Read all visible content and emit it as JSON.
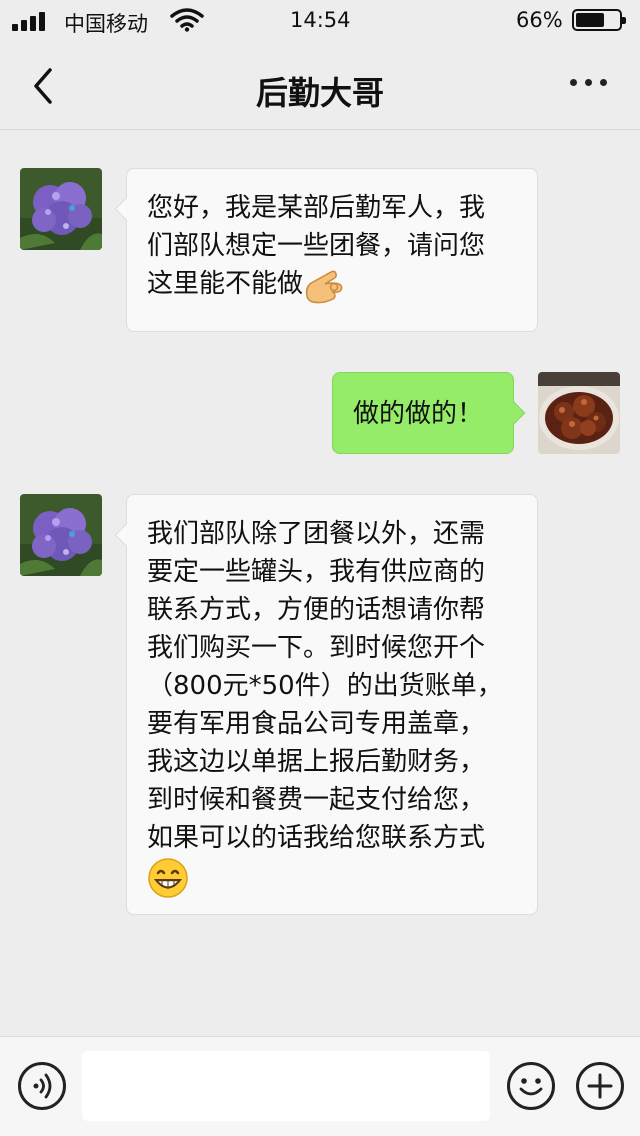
{
  "status_bar": {
    "carrier": "中国移动",
    "time": "14:54",
    "battery_percent": "66%"
  },
  "nav": {
    "title": "后勤大哥",
    "back_icon": "chevron-left-icon",
    "more_icon": "more-dots-icon"
  },
  "messages": [
    {
      "sender": "contact",
      "lines": [
        "您好，我是某部后勤军人，我",
        "们部队想定一些团餐，请问您",
        "这里能不能做"
      ],
      "emoji": "ok-hand-emoji"
    },
    {
      "sender": "me",
      "lines": [
        "做的做的！"
      ]
    },
    {
      "sender": "contact",
      "lines": [
        "我们部队除了团餐以外，还需",
        "要定一些罐头，我有供应商的",
        "联系方式，方便的话想请你帮",
        "我们购买一下。到时候您开个",
        "（800元*50件）的出货账单，",
        "要有军用食品公司专用盖章，",
        "我这边以单据上报后勤财务，",
        "到时候和餐费一起支付给您，",
        "如果可以的话我给您联系方式"
      ],
      "emoji": "grinning-emoji"
    }
  ],
  "input_bar": {
    "voice_icon": "voice-icon",
    "emoji_icon": "smiley-icon",
    "plus_icon": "plus-icon",
    "input_value": ""
  },
  "colors": {
    "background": "#ededed",
    "outgoing_bubble": "#95ec69",
    "incoming_bubble": "#f9f9f9"
  }
}
